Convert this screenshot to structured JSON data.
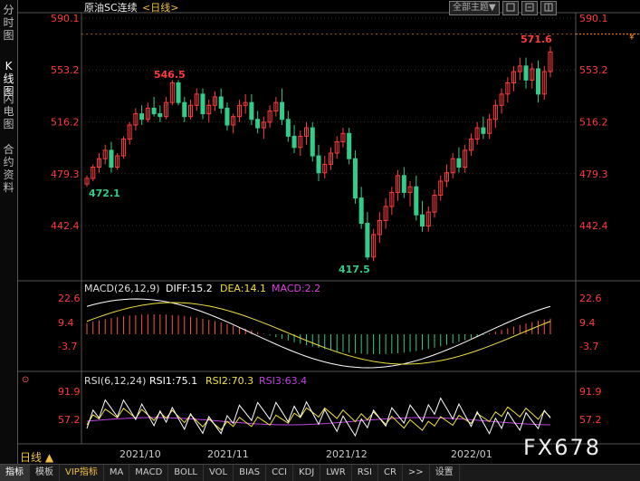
{
  "sidebar": {
    "items": [
      {
        "label": "分时图",
        "active": false
      },
      {
        "label": "K线图",
        "active": true
      },
      {
        "label": "闪电图",
        "active": false
      },
      {
        "label": "合约资料",
        "active": false
      }
    ]
  },
  "title": {
    "name": "原油SC连续",
    "period": "<日线>"
  },
  "topbar": {
    "theme_label": "全部主题",
    "dropdown": "▼"
  },
  "main_chart": {
    "y_ticks": [
      "590.1",
      "553.2",
      "516.2",
      "479.3",
      "442.4"
    ],
    "annotations": {
      "high": "571.6",
      "peak_left": "546.5",
      "low_start": "472.1",
      "low_mid": "417.5"
    },
    "up_color": "#ff3b3b",
    "down_color": "#33cc88"
  },
  "macd": {
    "label": "MACD(26,12,9)",
    "diff": "DIFF:15.2",
    "dea": "DEA:14.1",
    "macd": "MACD:2.2",
    "y_ticks": [
      "22.6",
      "9.4",
      "-3.7"
    ]
  },
  "rsi": {
    "label": "RSI(6,12,24)",
    "rsi1": "RSI1:75.1",
    "rsi2": "RSI2:70.3",
    "rsi3": "RSI3:63.4",
    "y_ticks": [
      "91.9",
      "57.2"
    ]
  },
  "x_axis": [
    "2021/10",
    "2021/11",
    "2021/12",
    "2022/01"
  ],
  "period_button": "日线 ▲",
  "watermark": "FX678",
  "bottom_tabs": [
    {
      "label": "指标",
      "active": true,
      "vip": false
    },
    {
      "label": "模板",
      "active": false,
      "vip": false
    },
    {
      "label": "VIP指标",
      "active": false,
      "vip": true
    },
    {
      "label": "MA",
      "active": false,
      "vip": false
    },
    {
      "label": "MACD",
      "active": false,
      "vip": false
    },
    {
      "label": "BOLL",
      "active": false,
      "vip": false
    },
    {
      "label": "VOL",
      "active": false,
      "vip": false
    },
    {
      "label": "BIAS",
      "active": false,
      "vip": false
    },
    {
      "label": "CCI",
      "active": false,
      "vip": false
    },
    {
      "label": "KDJ",
      "active": false,
      "vip": false
    },
    {
      "label": "LWR",
      "active": false,
      "vip": false
    },
    {
      "label": "RSI",
      "active": false,
      "vip": false
    },
    {
      "label": "CR",
      "active": false,
      "vip": false
    },
    {
      "label": ">>",
      "active": false,
      "vip": false
    },
    {
      "label": "设置",
      "active": false,
      "vip": false
    }
  ],
  "colors": {
    "diff": "#ffffff",
    "dea": "#f0e040",
    "macd_label": "#e040e0",
    "rsi1": "#ffffff",
    "rsi2": "#f0e040",
    "rsi3": "#c040e0",
    "axis_text": "#ff3b3b",
    "last_price_line": "#ff9020"
  },
  "chart_data": {
    "type": "candlestick",
    "candles": [
      [
        472,
        478,
        470,
        476
      ],
      [
        476,
        486,
        474,
        484
      ],
      [
        484,
        494,
        480,
        490
      ],
      [
        490,
        500,
        486,
        496
      ],
      [
        496,
        502,
        480,
        484
      ],
      [
        484,
        494,
        482,
        492
      ],
      [
        492,
        506,
        490,
        504
      ],
      [
        504,
        516,
        500,
        514
      ],
      [
        514,
        526,
        510,
        522
      ],
      [
        522,
        528,
        514,
        518
      ],
      [
        518,
        530,
        516,
        526
      ],
      [
        526,
        534,
        520,
        522
      ],
      [
        522,
        528,
        516,
        520
      ],
      [
        520,
        534,
        518,
        530
      ],
      [
        530,
        546,
        528,
        544
      ],
      [
        544,
        546,
        528,
        530
      ],
      [
        530,
        534,
        516,
        520
      ],
      [
        520,
        532,
        518,
        528
      ],
      [
        528,
        540,
        524,
        536
      ],
      [
        536,
        540,
        518,
        522
      ],
      [
        522,
        532,
        516,
        528
      ],
      [
        528,
        538,
        524,
        534
      ],
      [
        534,
        540,
        522,
        526
      ],
      [
        526,
        530,
        510,
        514
      ],
      [
        514,
        522,
        508,
        520
      ],
      [
        520,
        532,
        516,
        528
      ],
      [
        528,
        536,
        522,
        530
      ],
      [
        530,
        536,
        514,
        518
      ],
      [
        518,
        524,
        508,
        512
      ],
      [
        512,
        520,
        504,
        516
      ],
      [
        516,
        528,
        512,
        524
      ],
      [
        524,
        534,
        520,
        530
      ],
      [
        530,
        540,
        514,
        518
      ],
      [
        518,
        524,
        502,
        506
      ],
      [
        506,
        514,
        494,
        498
      ],
      [
        498,
        510,
        492,
        506
      ],
      [
        506,
        516,
        500,
        512
      ],
      [
        512,
        516,
        488,
        492
      ],
      [
        492,
        500,
        474,
        480
      ],
      [
        480,
        492,
        476,
        486
      ],
      [
        486,
        498,
        482,
        494
      ],
      [
        494,
        506,
        490,
        502
      ],
      [
        502,
        512,
        498,
        508
      ],
      [
        508,
        512,
        486,
        490
      ],
      [
        490,
        496,
        458,
        462
      ],
      [
        462,
        470,
        440,
        444
      ],
      [
        444,
        452,
        418,
        420
      ],
      [
        420,
        440,
        417,
        436
      ],
      [
        436,
        452,
        430,
        446
      ],
      [
        446,
        462,
        440,
        456
      ],
      [
        456,
        470,
        450,
        466
      ],
      [
        466,
        482,
        460,
        478
      ],
      [
        478,
        484,
        462,
        466
      ],
      [
        466,
        474,
        456,
        470
      ],
      [
        470,
        478,
        446,
        450
      ],
      [
        450,
        460,
        438,
        442
      ],
      [
        442,
        456,
        438,
        452
      ],
      [
        452,
        468,
        448,
        464
      ],
      [
        464,
        478,
        460,
        474
      ],
      [
        474,
        486,
        470,
        480
      ],
      [
        480,
        494,
        476,
        490
      ],
      [
        490,
        498,
        480,
        484
      ],
      [
        484,
        500,
        480,
        496
      ],
      [
        496,
        508,
        492,
        504
      ],
      [
        504,
        516,
        500,
        512
      ],
      [
        512,
        520,
        504,
        508
      ],
      [
        508,
        522,
        504,
        518
      ],
      [
        518,
        532,
        512,
        528
      ],
      [
        528,
        540,
        522,
        536
      ],
      [
        536,
        548,
        530,
        544
      ],
      [
        544,
        556,
        538,
        552
      ],
      [
        552,
        562,
        546,
        556
      ],
      [
        556,
        562,
        540,
        546
      ],
      [
        546,
        558,
        540,
        554
      ],
      [
        554,
        560,
        530,
        536
      ],
      [
        536,
        556,
        532,
        552
      ],
      [
        552,
        570,
        548,
        566
      ]
    ],
    "ylim": [
      417.5,
      590.1
    ],
    "x_labels": [
      "2021/10",
      "2021/11",
      "2021/12",
      "2022/01"
    ],
    "series": [
      {
        "name": "DIFF",
        "value": 15.2
      },
      {
        "name": "DEA",
        "value": 14.1
      },
      {
        "name": "MACD",
        "value": 2.2
      },
      {
        "name": "RSI1",
        "value": 75.1
      },
      {
        "name": "RSI2",
        "value": 70.3
      },
      {
        "name": "RSI3",
        "value": 63.4
      }
    ]
  }
}
